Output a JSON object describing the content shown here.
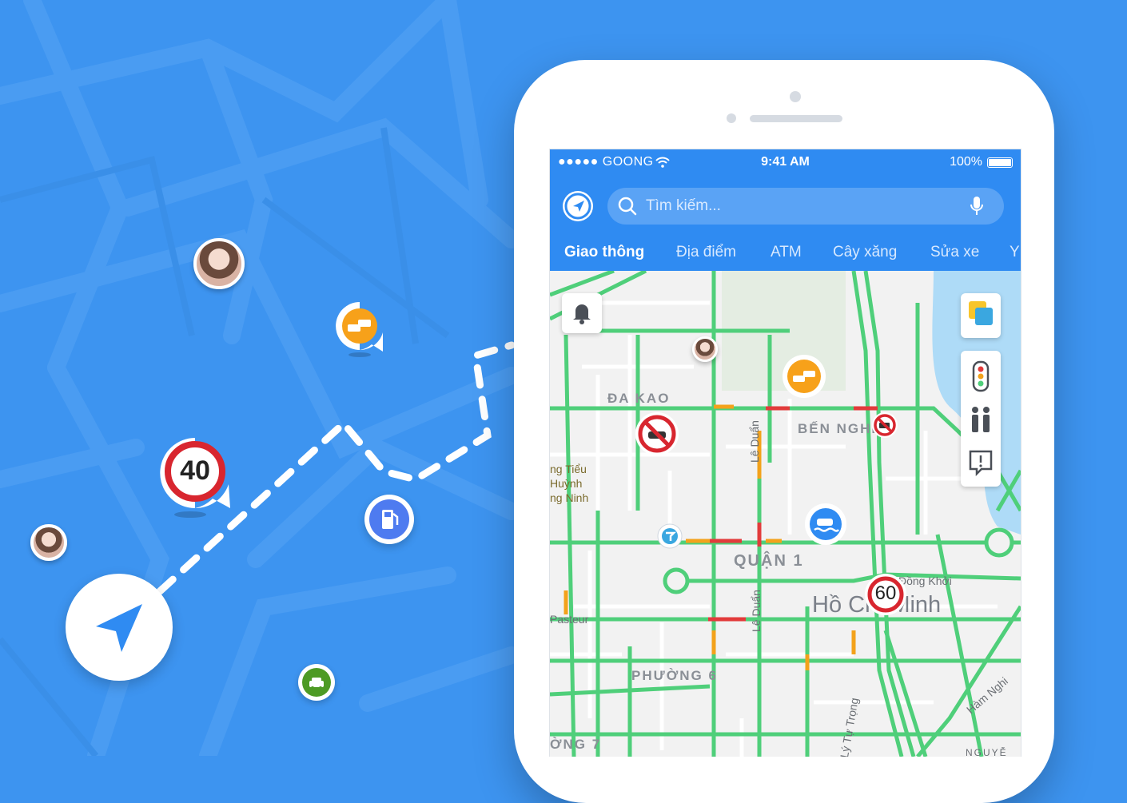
{
  "status_bar": {
    "carrier": "●●●●● GOONG",
    "time": "9:41 AM",
    "battery": "100%"
  },
  "search": {
    "placeholder": "Tìm kiếm..."
  },
  "tabs": [
    {
      "label": "Giao thông",
      "active": true
    },
    {
      "label": "Địa điểm",
      "active": false
    },
    {
      "label": "ATM",
      "active": false
    },
    {
      "label": "Cây xăng",
      "active": false
    },
    {
      "label": "Sửa xe",
      "active": false
    },
    {
      "label": "Y",
      "active": false
    }
  ],
  "map_labels": {
    "da_kao": "ĐA KAO",
    "ben_nghe": "BẾN NGHÉ",
    "quan_1": "QUẬN 1",
    "phuong_6": "PHƯỜNG 6",
    "phuong_7": "ỜNG 7",
    "ho_chi_minh": "Hồ Chí Minh",
    "le_duan_1": "Lê Duẩn",
    "le_duan_2": "Lê Duẩn",
    "dong_khoi": "Đồng Khởi",
    "ham_nghi": "Hàm Nghi",
    "ly_tu_trong": "Lý Tự Trọng",
    "pasteur": "Pasteur",
    "nguyen": "NGUYỄ",
    "landmark_1": "ng Tiểu",
    "landmark_2": "Huỳnh",
    "landmark_3": "ng Ninh"
  },
  "speed_signs": {
    "outside": "40",
    "on_map": "60"
  },
  "colors": {
    "background": "#3d94f0",
    "header": "#2f8bf2",
    "traffic_green": "#4fcf7a",
    "traffic_red": "#e23b3b",
    "traffic_orange": "#f3a21b",
    "warning_orange": "#f7a11a",
    "speed_red": "#d8262f"
  },
  "icons": {
    "status": [
      "wifi-icon",
      "battery-icon"
    ],
    "header": [
      "goong-logo-icon",
      "search-icon",
      "microphone-icon"
    ],
    "map_controls": [
      "notification-bell-icon",
      "map-layers-icon",
      "traffic-light-icon",
      "people-icon",
      "report-icon"
    ],
    "markers": [
      "traffic-jam-icon",
      "no-car-icon",
      "no-truck-icon",
      "flood-icon",
      "repair-icon",
      "fuel-icon",
      "navigation-arrow-icon"
    ]
  }
}
